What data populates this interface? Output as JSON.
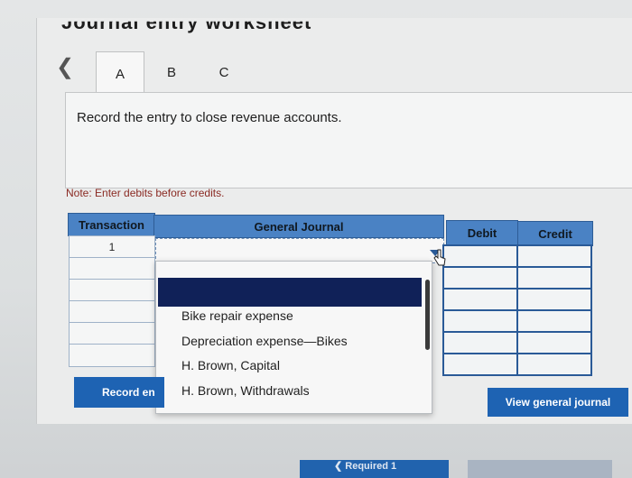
{
  "window": {
    "title": "Journal entry worksheet"
  },
  "tabs": {
    "prev_icon": "chevron-left-icon",
    "items": [
      {
        "label": "A",
        "active": true
      },
      {
        "label": "B",
        "active": false
      },
      {
        "label": "C",
        "active": false
      }
    ]
  },
  "instruction": "Record the entry to close revenue accounts.",
  "note": "Note: Enter debits before credits.",
  "table": {
    "headers": {
      "transaction": "Transaction",
      "general_journal": "General Journal",
      "debit": "Debit",
      "credit": "Credit"
    },
    "rows": [
      {
        "transaction": "1",
        "account": "",
        "debit": "",
        "credit": ""
      },
      {
        "transaction": "",
        "account": "",
        "debit": "",
        "credit": ""
      },
      {
        "transaction": "",
        "account": "",
        "debit": "",
        "credit": ""
      },
      {
        "transaction": "",
        "account": "",
        "debit": "",
        "credit": ""
      },
      {
        "transaction": "",
        "account": "",
        "debit": "",
        "credit": ""
      },
      {
        "transaction": "",
        "account": "",
        "debit": "",
        "credit": ""
      }
    ]
  },
  "dropdown": {
    "selected": "",
    "options": [
      "Bike repair expense",
      "Depreciation expense—Bikes",
      "H. Brown, Capital",
      "H. Brown, Withdrawals"
    ]
  },
  "buttons": {
    "record_entry": "Record en",
    "view_general_journal": "View general journal",
    "required": "Required 1"
  },
  "colors": {
    "accent": "#1e63b3",
    "header": "#4a82c4",
    "selected_option": "#102158",
    "note": "#8a2a23"
  }
}
